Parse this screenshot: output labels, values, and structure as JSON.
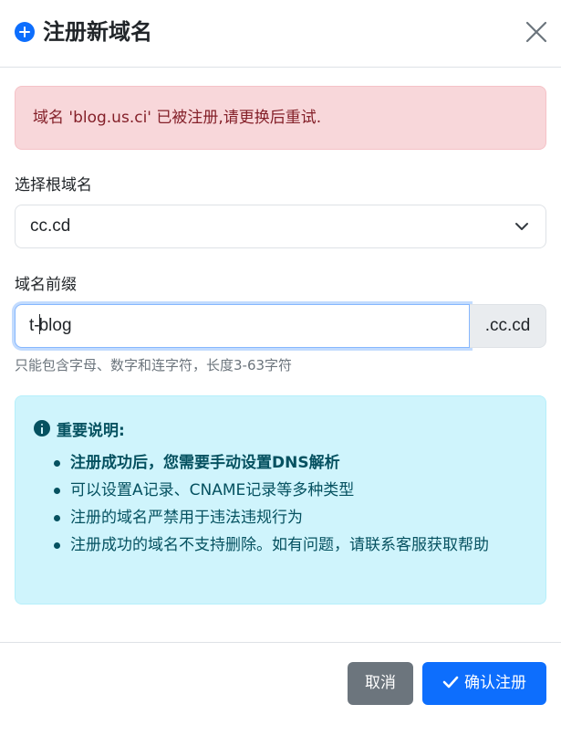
{
  "modal": {
    "title": "注册新域名",
    "title_icon": "plus-circle-icon",
    "close_icon": "close-icon"
  },
  "error": {
    "message": "域名 'blog.us.ci' 已被注册,请更换后重试."
  },
  "root_domain": {
    "label": "选择根域名",
    "selected": "cc.cd",
    "icon": "chevron-down-icon"
  },
  "prefix": {
    "label": "域名前缀",
    "value_before_caret": "t-",
    "value_after_caret": "blog",
    "suffix": ".cc.cd",
    "help": "只能包含字母、数字和连字符，长度3-63字符"
  },
  "info": {
    "icon": "info-circle-icon",
    "title": "重要说明:",
    "items": [
      "注册成功后，您需要手动设置DNS解析",
      "可以设置A记录、CNAME记录等多种类型",
      "注册的域名严禁用于违法违规行为",
      "注册成功的域名不支持删除。如有问题，请联系客服获取帮助"
    ]
  },
  "footer": {
    "cancel_label": "取消",
    "confirm_label": "确认注册",
    "confirm_icon": "check-icon"
  },
  "colors": {
    "primary": "#0d6efd",
    "secondary": "#6c757d",
    "danger_bg": "#f8d7da",
    "danger_text": "#842029",
    "info_bg": "#cff4fc",
    "info_text": "#055160"
  }
}
